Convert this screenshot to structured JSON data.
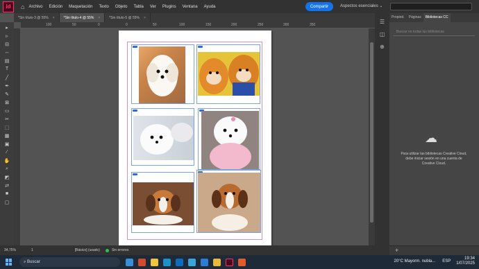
{
  "app": {
    "logo": "Id"
  },
  "menubar": {
    "items": [
      "Archivo",
      "Edición",
      "Maquetación",
      "Texto",
      "Objeto",
      "Tabla",
      "Ver",
      "Plugins",
      "Ventana",
      "Ayuda"
    ],
    "share_label": "Compartir",
    "workspace": "Aspectos esenciales"
  },
  "tabs": [
    {
      "label": "*Sin título-3 @ 55%",
      "active": false
    },
    {
      "label": "*Sin título-4 @ 55%",
      "active": true
    },
    {
      "label": "*Sin título-5 @ 55%",
      "active": false
    }
  ],
  "ruler": {
    "marks": [
      "150",
      "100",
      "50",
      "0",
      "50",
      "100",
      "150",
      "200",
      "250",
      "300",
      "350"
    ]
  },
  "status": {
    "zoom": "34,75%",
    "page": "1",
    "style": "[Básico] (usado)",
    "errors": "Sin errores"
  },
  "panel": {
    "tabs": [
      "Propied.",
      "Páginas",
      "Bibliotecas CC"
    ],
    "search_placeholder": "Buscar en todas las bibliotecas",
    "message": "Para utilizar las bibliotecas Creative Cloud, debe iniciar sesión en una cuenta de Creative Cloud."
  },
  "taskbar": {
    "search": "Buscar",
    "weather": "20°C  Mayorm. nubla...",
    "lang": "ESP",
    "time": "19:34",
    "date": "1/07/2025"
  },
  "colors": {
    "accent": "#1473e6",
    "brand": "#ff3366"
  }
}
